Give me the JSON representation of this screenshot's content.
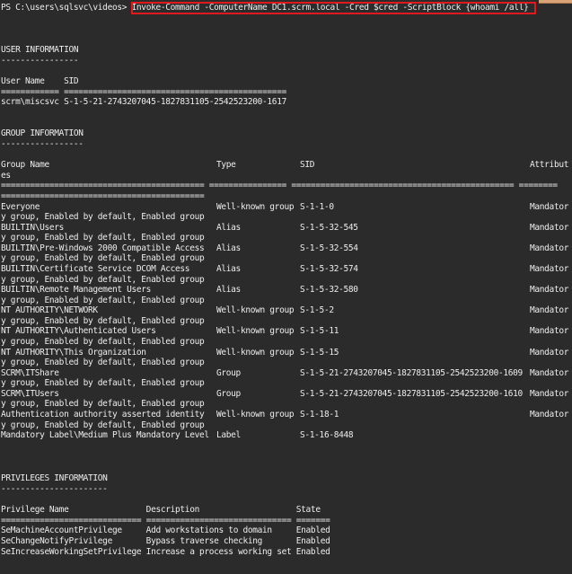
{
  "prompt": "PS C:\\users\\sqlsvc\\videos> ",
  "command": "Invoke-Command -ComputerName DC1.scrm.local -Cred $cred -ScriptBlock {whoami /all}",
  "user_info": {
    "title": "USER INFORMATION",
    "underline": "----------------",
    "header": "User Name    SID",
    "sep": "============ ==============================================",
    "row": "scrm\\miscsvc S-1-5-21-2743207045-1827831105-2542523200-1617"
  },
  "group_info": {
    "title": "GROUP INFORMATION",
    "underline": "-----------------",
    "col_name": "Group Name",
    "col_name_wrap": "es",
    "col_type": "Type",
    "col_sid": "SID",
    "col_attr": "Attribut",
    "sep1": "========================================== ================ ============================================== ========",
    "sep2": "==========================================",
    "rows": [
      {
        "name": "Everyone",
        "type": "Well-known group",
        "sid": "S-1-1-0",
        "attr": "Mandator",
        "wrap": "y group, Enabled by default, Enabled group"
      },
      {
        "name": "BUILTIN\\Users",
        "type": "Alias",
        "sid": "S-1-5-32-545",
        "attr": "Mandator",
        "wrap": "y group, Enabled by default, Enabled group"
      },
      {
        "name": "BUILTIN\\Pre-Windows 2000 Compatible Access",
        "type": "Alias",
        "sid": "S-1-5-32-554",
        "attr": "Mandator",
        "wrap": "y group, Enabled by default, Enabled group"
      },
      {
        "name": "BUILTIN\\Certificate Service DCOM Access",
        "type": "Alias",
        "sid": "S-1-5-32-574",
        "attr": "Mandator",
        "wrap": "y group, Enabled by default, Enabled group"
      },
      {
        "name": "BUILTIN\\Remote Management Users",
        "type": "Alias",
        "sid": "S-1-5-32-580",
        "attr": "Mandator",
        "wrap": "y group, Enabled by default, Enabled group"
      },
      {
        "name": "NT AUTHORITY\\NETWORK",
        "type": "Well-known group",
        "sid": "S-1-5-2",
        "attr": "Mandator",
        "wrap": "y group, Enabled by default, Enabled group"
      },
      {
        "name": "NT AUTHORITY\\Authenticated Users",
        "type": "Well-known group",
        "sid": "S-1-5-11",
        "attr": "Mandator",
        "wrap": "y group, Enabled by default, Enabled group"
      },
      {
        "name": "NT AUTHORITY\\This Organization",
        "type": "Well-known group",
        "sid": "S-1-5-15",
        "attr": "Mandator",
        "wrap": "y group, Enabled by default, Enabled group"
      },
      {
        "name": "SCRM\\ITShare",
        "type": "Group",
        "sid": "S-1-5-21-2743207045-1827831105-2542523200-1609",
        "attr": "Mandator",
        "wrap": "y group, Enabled by default, Enabled group"
      },
      {
        "name": "SCRM\\ITUsers",
        "type": "Group",
        "sid": "S-1-5-21-2743207045-1827831105-2542523200-1610",
        "attr": "Mandator",
        "wrap": "y group, Enabled by default, Enabled group"
      },
      {
        "name": "Authentication authority asserted identity",
        "type": "Well-known group",
        "sid": "S-1-18-1",
        "attr": "Mandator",
        "wrap": "y group, Enabled by default, Enabled group"
      },
      {
        "name": "Mandatory Label\\Medium Plus Mandatory Level",
        "type": "Label",
        "sid": "S-1-16-8448",
        "attr": "",
        "wrap": ""
      }
    ]
  },
  "priv_info": {
    "title": "PRIVILEGES INFORMATION",
    "underline": "----------------------",
    "header": "Privilege Name                Description                    State",
    "sep": "============================= ============================== =======",
    "rows": [
      "SeMachineAccountPrivilege     Add workstations to domain     Enabled",
      "SeChangeNotifyPrivilege       Bypass traverse checking       Enabled",
      "SeIncreaseWorkingSetPrivilege Increase a process working set Enabled"
    ]
  }
}
